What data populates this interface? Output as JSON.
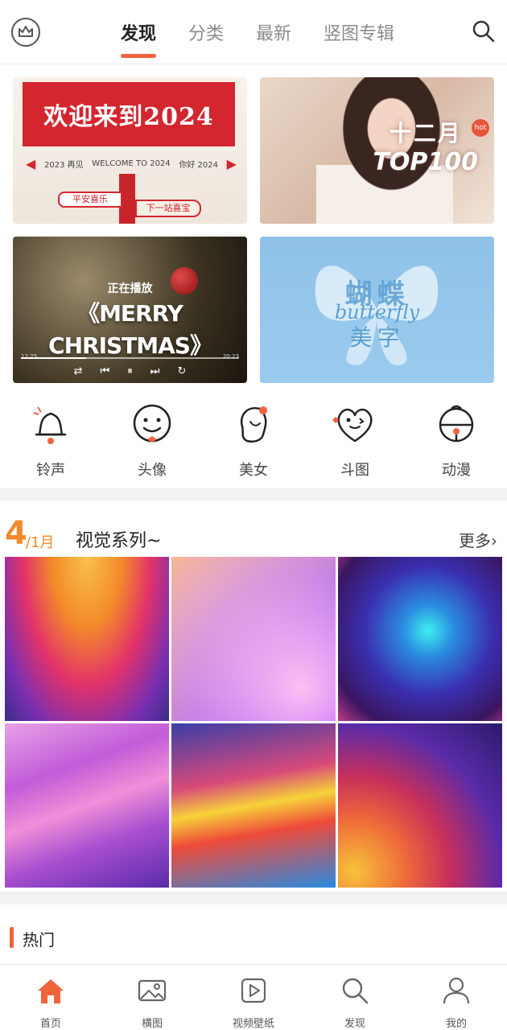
{
  "header": {
    "tabs": [
      {
        "label": "发现",
        "active": true
      },
      {
        "label": "分类",
        "active": false
      },
      {
        "label": "最新",
        "active": false
      },
      {
        "label": "竖图专辑",
        "active": false
      }
    ],
    "left_icon": "crown-icon",
    "right_icon": "search-icon",
    "accent_color": "#f0643c"
  },
  "banners": {
    "welcome": {
      "title": "欢迎来到2024",
      "year_left": "2023 再见",
      "middle": "WELCOME TO 2024",
      "year_right": "你好 2024",
      "sign_left": "平安喜乐",
      "sign_right": "下一站喜宝"
    },
    "top100": {
      "line1": "十二月",
      "line2": "TOP100",
      "badge": "hot"
    },
    "xmas": {
      "now_playing": "正在播放",
      "title": "《MERRY CHRISTMAS》",
      "time_start": "12:25",
      "time_end": "20:23",
      "progress": 0.3
    },
    "butterfly": {
      "line1": "蝴蝶",
      "script": "butterfly",
      "line2": "美字"
    }
  },
  "categories": [
    {
      "label": "铃声",
      "icon": "bell-icon"
    },
    {
      "label": "头像",
      "icon": "smiley-face-icon"
    },
    {
      "label": "美女",
      "icon": "girl-profile-icon"
    },
    {
      "label": "斗图",
      "icon": "heart-face-icon"
    },
    {
      "label": "动漫",
      "icon": "anime-bell-icon"
    }
  ],
  "series": {
    "day": "4",
    "month": "/1月",
    "title": "视觉系列~",
    "more": "更多›"
  },
  "hot": {
    "title": "热门"
  },
  "bottom_nav": [
    {
      "label": "首页",
      "icon": "home-icon",
      "active": true
    },
    {
      "label": "横图",
      "icon": "image-icon",
      "active": false
    },
    {
      "label": "视频壁纸",
      "icon": "video-play-icon",
      "active": false
    },
    {
      "label": "发现",
      "icon": "search-icon",
      "active": false
    },
    {
      "label": "我的",
      "icon": "user-icon",
      "active": false
    }
  ]
}
